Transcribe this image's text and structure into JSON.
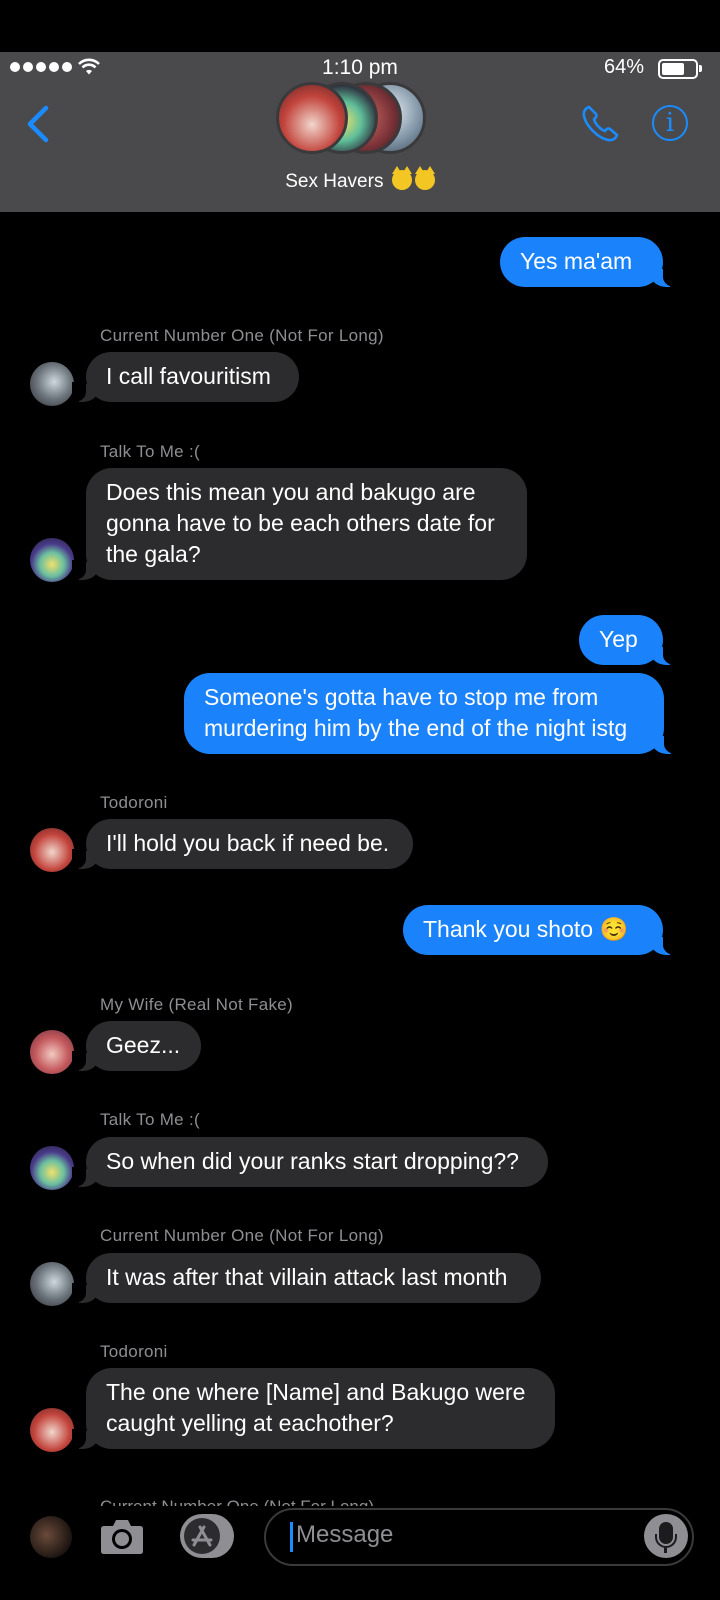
{
  "status_bar": {
    "time": "1:10 pm",
    "battery": "64%"
  },
  "header": {
    "group_name": "Sex Havers",
    "emoji": [
      "smiling-cat-face-with-horns",
      "smiling-cat-face-with-horns"
    ]
  },
  "messages": [
    {
      "dir": "out",
      "text": "Yes ma'am"
    },
    {
      "dir": "in",
      "sender": "Current Number One (Not For Long)",
      "avatar": "avatar-gray",
      "text": "I call favouritism"
    },
    {
      "dir": "in",
      "sender": "Talk To Me :(",
      "avatar": "avatar-purple",
      "text": "Does this mean you and bakugo are gonna have to be each others date for the gala?"
    },
    {
      "dir": "out",
      "text": "Yep"
    },
    {
      "dir": "out",
      "text": "Someone's gotta have to stop me from murdering him by the end of the night istg"
    },
    {
      "dir": "in",
      "sender": "Todoroni",
      "avatar": "avatar-red",
      "text": "I'll hold you back if need be."
    },
    {
      "dir": "out",
      "text": "Thank you shoto ☺️"
    },
    {
      "dir": "in",
      "sender": "My Wife (Real Not Fake)",
      "avatar": "avatar-pink",
      "text": "Geez..."
    },
    {
      "dir": "in",
      "sender": "Talk To Me :(",
      "avatar": "avatar-purple",
      "text": "So when did your ranks start dropping??"
    },
    {
      "dir": "in",
      "sender": "Current Number One (Not For Long)",
      "avatar": "avatar-gray",
      "text": "It was after that villain attack last month"
    },
    {
      "dir": "in",
      "sender": "Todoroni",
      "avatar": "avatar-red",
      "text": "The one where [Name] and Bakugo were caught yelling at eachother?"
    },
    {
      "sender": "Current Number One (Not For Long)"
    }
  ],
  "input": {
    "placeholder": "Message"
  },
  "colors": {
    "accent": "#1a8cff",
    "outgoing": "#1a82fb",
    "incoming": "#2c2c2e",
    "header": "#4a4a4c"
  }
}
